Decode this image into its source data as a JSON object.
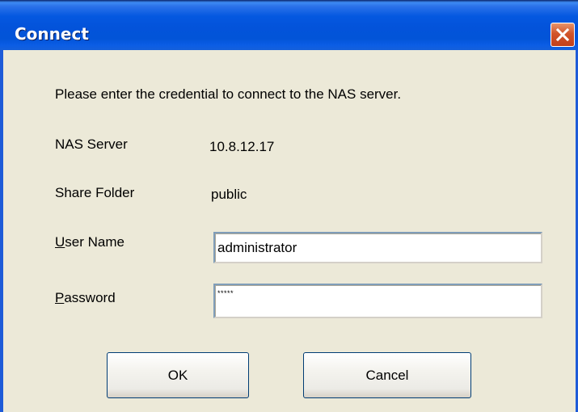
{
  "window": {
    "title": "Connect"
  },
  "dialog": {
    "message": "Please enter the credential to connect to the NAS server.",
    "nas_server_label": "NAS Server",
    "nas_server_value": "10.8.12.17",
    "share_folder_label": "Share Folder",
    "share_folder_value": "public",
    "username_label_underlined": "U",
    "username_label_rest": "ser Name",
    "username_value": "administrator",
    "password_label_underlined": "P",
    "password_label_rest": "assword",
    "password_value": "*****"
  },
  "buttons": {
    "ok_label": "OK",
    "cancel_label": "Cancel"
  },
  "icons": {
    "close": "close-icon"
  },
  "colors": {
    "titlebar": "#0454DD",
    "close_button": "#D2542A",
    "dialog_background": "#ECE9D8"
  }
}
